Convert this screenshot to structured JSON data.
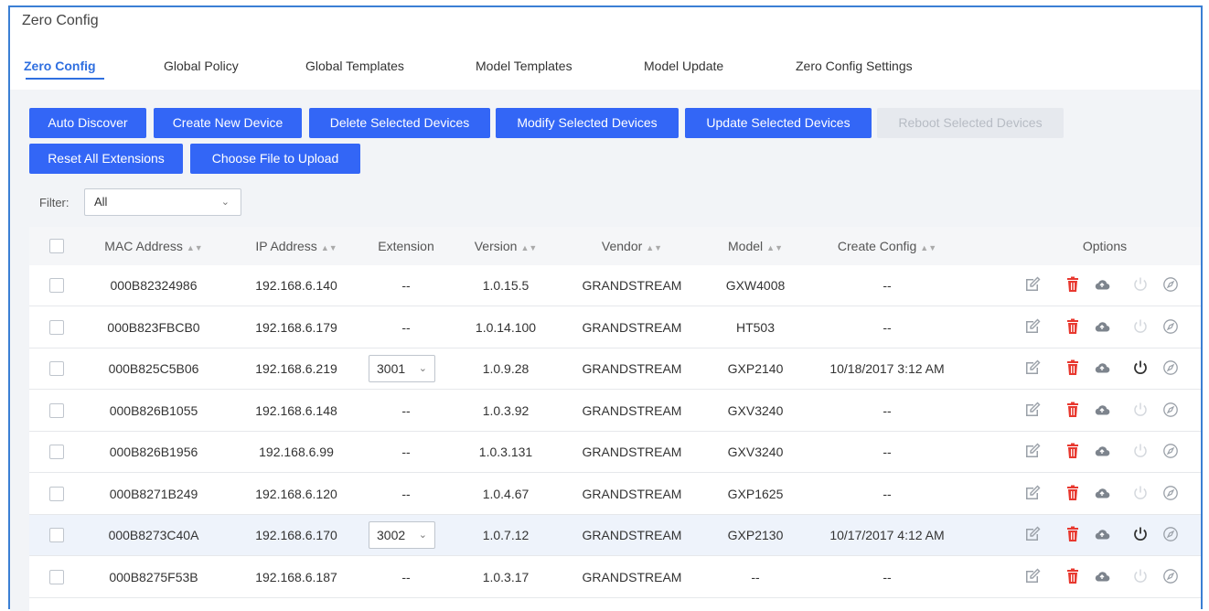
{
  "page_title": "Zero Config",
  "tabs": [
    {
      "label": "Zero Config",
      "active": true
    },
    {
      "label": "Global Policy"
    },
    {
      "label": "Global Templates"
    },
    {
      "label": "Model Templates"
    },
    {
      "label": "Model Update"
    },
    {
      "label": "Zero Config Settings"
    }
  ],
  "buttons": [
    {
      "label": "Auto Discover"
    },
    {
      "label": "Create New Device"
    },
    {
      "label": "Delete Selected Devices"
    },
    {
      "label": "Modify Selected Devices"
    },
    {
      "label": "Update Selected Devices"
    },
    {
      "label": "Reboot Selected Devices",
      "disabled": true
    },
    {
      "label": "Reset All Extensions"
    },
    {
      "label": "Choose File to Upload"
    }
  ],
  "filter": {
    "label": "Filter:",
    "value": "All"
  },
  "columns": {
    "mac": "MAC Address",
    "ip": "IP Address",
    "extension": "Extension",
    "version": "Version",
    "vendor": "Vendor",
    "model": "Model",
    "create_config": "Create Config",
    "options": "Options"
  },
  "rows": [
    {
      "mac": "000B82324986",
      "ip": "192.168.6.140",
      "extension": "--",
      "version": "1.0.15.5",
      "vendor": "GRANDSTREAM",
      "model": "GXW4008",
      "create_config": "--",
      "reboot_enabled": false,
      "highlighted": false
    },
    {
      "mac": "000B823FBCB0",
      "ip": "192.168.6.179",
      "extension": "--",
      "version": "1.0.14.100",
      "vendor": "GRANDSTREAM",
      "model": "HT503",
      "create_config": "--",
      "reboot_enabled": false,
      "highlighted": false
    },
    {
      "mac": "000B825C5B06",
      "ip": "192.168.6.219",
      "extension": "3001",
      "version": "1.0.9.28",
      "vendor": "GRANDSTREAM",
      "model": "GXP2140",
      "create_config": "10/18/2017 3:12 AM",
      "reboot_enabled": true,
      "highlighted": false
    },
    {
      "mac": "000B826B1055",
      "ip": "192.168.6.148",
      "extension": "--",
      "version": "1.0.3.92",
      "vendor": "GRANDSTREAM",
      "model": "GXV3240",
      "create_config": "--",
      "reboot_enabled": false,
      "highlighted": false
    },
    {
      "mac": "000B826B1956",
      "ip": "192.168.6.99",
      "extension": "--",
      "version": "1.0.3.131",
      "vendor": "GRANDSTREAM",
      "model": "GXV3240",
      "create_config": "--",
      "reboot_enabled": false,
      "highlighted": false
    },
    {
      "mac": "000B8271B249",
      "ip": "192.168.6.120",
      "extension": "--",
      "version": "1.0.4.67",
      "vendor": "GRANDSTREAM",
      "model": "GXP1625",
      "create_config": "--",
      "reboot_enabled": false,
      "highlighted": false
    },
    {
      "mac": "000B8273C40A",
      "ip": "192.168.6.170",
      "extension": "3002",
      "version": "1.0.7.12",
      "vendor": "GRANDSTREAM",
      "model": "GXP2130",
      "create_config": "10/17/2017 4:12 AM",
      "reboot_enabled": true,
      "highlighted": true
    },
    {
      "mac": "000B8275F53B",
      "ip": "192.168.6.187",
      "extension": "--",
      "version": "1.0.3.17",
      "vendor": "GRANDSTREAM",
      "model": "--",
      "create_config": "--",
      "reboot_enabled": false,
      "highlighted": false
    }
  ],
  "colors": {
    "primary": "#3366f6",
    "accent": "#2f6fe0",
    "delete_red": "#e8382f",
    "frame_border": "#3b7fd4",
    "disabled_bg": "#e6e9ee"
  },
  "icons": [
    "edit-icon",
    "delete-icon",
    "cloud-upload-icon",
    "power-icon",
    "compass-icon"
  ]
}
